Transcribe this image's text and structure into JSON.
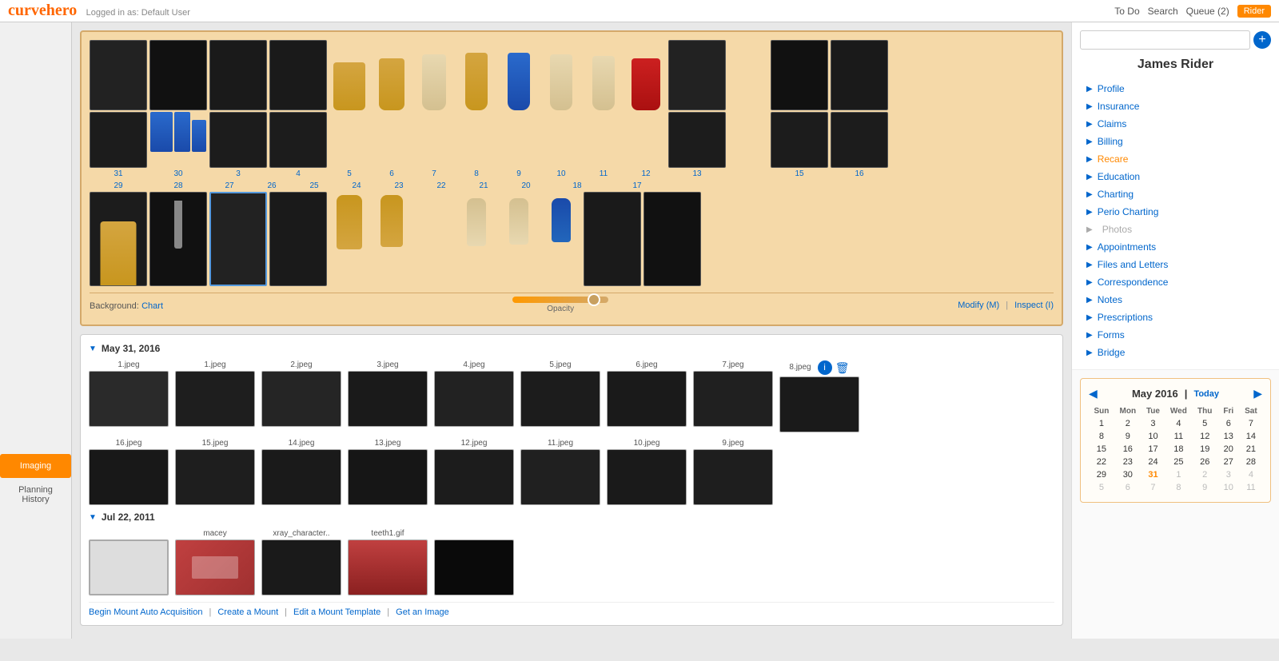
{
  "topbar": {
    "logo": "curvehero",
    "logged_in": "Logged in as: Default User",
    "nav": [
      "To Do",
      "Search",
      "Queue (2)",
      "Rider"
    ],
    "active_user": "Rider"
  },
  "patient": {
    "name": "James Rider"
  },
  "nav_menu": [
    {
      "label": "Profile",
      "active": false,
      "disabled": false
    },
    {
      "label": "Insurance",
      "active": false,
      "disabled": false
    },
    {
      "label": "Claims",
      "active": false,
      "disabled": false
    },
    {
      "label": "Billing",
      "active": false,
      "disabled": false
    },
    {
      "label": "Recare",
      "active": true,
      "disabled": false
    },
    {
      "label": "Education",
      "active": false,
      "disabled": false
    },
    {
      "label": "Charting",
      "active": false,
      "disabled": false
    },
    {
      "label": "Perio Charting",
      "active": false,
      "disabled": false
    },
    {
      "label": "Photos",
      "active": false,
      "disabled": true
    },
    {
      "label": "Appointments",
      "active": false,
      "disabled": false
    },
    {
      "label": "Files and Letters",
      "active": false,
      "disabled": false
    },
    {
      "label": "Correspondence",
      "active": false,
      "disabled": false
    },
    {
      "label": "Notes",
      "active": false,
      "disabled": false
    },
    {
      "label": "Prescriptions",
      "active": false,
      "disabled": false
    },
    {
      "label": "Forms",
      "active": false,
      "disabled": false
    },
    {
      "label": "Bridge",
      "active": false,
      "disabled": false
    }
  ],
  "chart": {
    "background_label": "Background:",
    "background_value": "Chart",
    "opacity_label": "Opacity",
    "modify_label": "Modify (M)",
    "inspect_label": "Inspect (I)",
    "top_numbers": [
      "3",
      "4",
      "5",
      "6",
      "7",
      "8",
      "9",
      "10",
      "11",
      "12",
      "13",
      "15",
      "16"
    ],
    "bottom_numbers": [
      "31",
      "30",
      "29",
      "28",
      "27",
      "26",
      "25",
      "24",
      "23",
      "22",
      "21",
      "20",
      "18",
      "17"
    ]
  },
  "gallery": {
    "sections": [
      {
        "date": "May 31, 2016",
        "collapsed": false,
        "rows": [
          {
            "images": [
              {
                "label": "1.jpeg"
              },
              {
                "label": "1.jpeg"
              },
              {
                "label": "2.jpeg"
              },
              {
                "label": "3.jpeg"
              },
              {
                "label": "4.jpeg"
              },
              {
                "label": "5.jpeg"
              },
              {
                "label": "6.jpeg"
              },
              {
                "label": "7.jpeg"
              },
              {
                "label": "8.jpeg",
                "has_info": true,
                "has_delete": true
              }
            ]
          },
          {
            "images": [
              {
                "label": "16.jpeg"
              },
              {
                "label": "15.jpeg"
              },
              {
                "label": "14.jpeg"
              },
              {
                "label": "13.jpeg"
              },
              {
                "label": "12.jpeg"
              },
              {
                "label": "11.jpeg"
              },
              {
                "label": "10.jpeg"
              },
              {
                "label": "9.jpeg"
              }
            ]
          }
        ]
      },
      {
        "date": "Jul 22, 2011",
        "collapsed": false,
        "rows": [
          {
            "images": [
              {
                "label": ""
              },
              {
                "label": "macey"
              },
              {
                "label": "xray_character.."
              },
              {
                "label": "teeth1.gif"
              },
              {
                "label": ""
              }
            ]
          }
        ]
      }
    ],
    "actions": [
      "Begin Mount Auto Acquisition",
      "Create a Mount",
      "Edit a Mount Template",
      "Get an Image"
    ]
  },
  "left_tabs": [
    {
      "label": "Imaging",
      "active": true
    },
    {
      "label": "Planning\nHistory",
      "active": false
    }
  ],
  "calendar": {
    "month": "May",
    "year": "2016",
    "today_label": "Today",
    "days_header": [
      "Sun",
      "Mon",
      "Tue",
      "Wed",
      "Thu",
      "Fri",
      "Sat"
    ],
    "weeks": [
      [
        {
          "day": "1",
          "type": "normal"
        },
        {
          "day": "2",
          "type": "normal"
        },
        {
          "day": "3",
          "type": "normal"
        },
        {
          "day": "4",
          "type": "normal"
        },
        {
          "day": "5",
          "type": "normal"
        },
        {
          "day": "6",
          "type": "normal"
        },
        {
          "day": "7",
          "type": "normal"
        }
      ],
      [
        {
          "day": "8",
          "type": "normal"
        },
        {
          "day": "9",
          "type": "normal"
        },
        {
          "day": "10",
          "type": "normal"
        },
        {
          "day": "11",
          "type": "normal"
        },
        {
          "day": "12",
          "type": "normal"
        },
        {
          "day": "13",
          "type": "normal"
        },
        {
          "day": "14",
          "type": "normal"
        }
      ],
      [
        {
          "day": "15",
          "type": "normal"
        },
        {
          "day": "16",
          "type": "normal"
        },
        {
          "day": "17",
          "type": "normal"
        },
        {
          "day": "18",
          "type": "normal"
        },
        {
          "day": "19",
          "type": "normal"
        },
        {
          "day": "20",
          "type": "normal"
        },
        {
          "day": "21",
          "type": "normal"
        }
      ],
      [
        {
          "day": "22",
          "type": "normal"
        },
        {
          "day": "23",
          "type": "normal"
        },
        {
          "day": "24",
          "type": "normal"
        },
        {
          "day": "25",
          "type": "normal"
        },
        {
          "day": "26",
          "type": "normal"
        },
        {
          "day": "27",
          "type": "normal"
        },
        {
          "day": "28",
          "type": "normal"
        }
      ],
      [
        {
          "day": "29",
          "type": "normal"
        },
        {
          "day": "30",
          "type": "normal"
        },
        {
          "day": "31",
          "type": "today"
        },
        {
          "day": "1",
          "type": "other"
        },
        {
          "day": "2",
          "type": "other"
        },
        {
          "day": "3",
          "type": "other"
        },
        {
          "day": "4",
          "type": "other"
        }
      ],
      [
        {
          "day": "5",
          "type": "other"
        },
        {
          "day": "6",
          "type": "other"
        },
        {
          "day": "7",
          "type": "other"
        },
        {
          "day": "8",
          "type": "other"
        },
        {
          "day": "9",
          "type": "other"
        },
        {
          "day": "10",
          "type": "other"
        },
        {
          "day": "11",
          "type": "other"
        }
      ]
    ]
  }
}
